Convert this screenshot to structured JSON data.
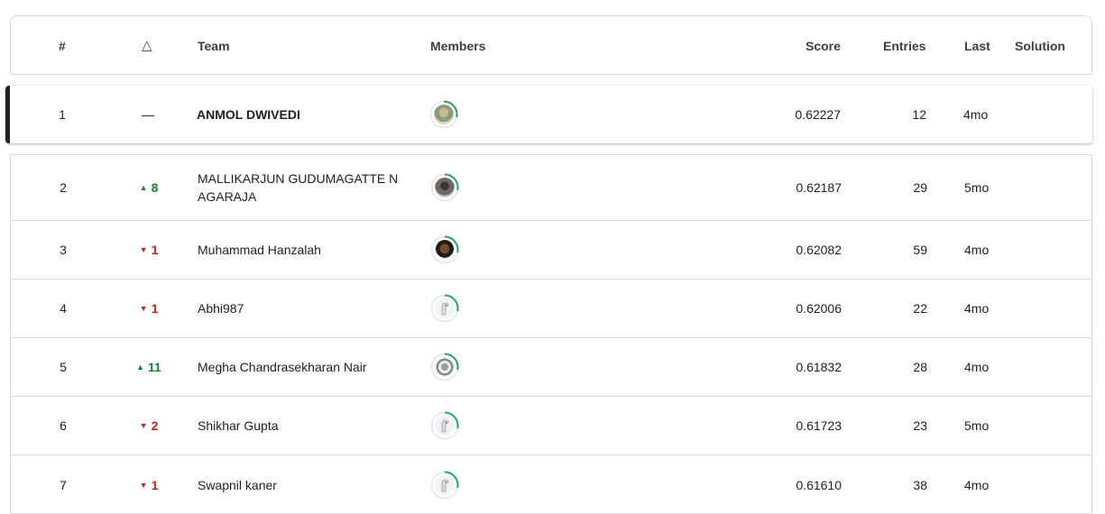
{
  "header": {
    "rank": "#",
    "delta": "△",
    "team": "Team",
    "members": "Members",
    "score": "Score",
    "entries": "Entries",
    "last": "Last",
    "solution": "Solution"
  },
  "you_row": {
    "rank": "1",
    "delta": "—",
    "team": "ANMOL DWIVEDI",
    "avatar": "photo-avatar",
    "score": "0.62227",
    "entries": "12",
    "last": "4mo"
  },
  "rows": [
    {
      "rank": "2",
      "delta_dir": "up",
      "delta": "8",
      "team": "MALLIKARJUN GUDUMAGATTE N AGARAJA",
      "avatar": "photo-avatar",
      "score": "0.62187",
      "entries": "29",
      "last": "5mo"
    },
    {
      "rank": "3",
      "delta_dir": "down",
      "delta": "1",
      "team": "Muhammad Hanzalah",
      "avatar": "photo-avatar",
      "score": "0.62082",
      "entries": "59",
      "last": "4mo"
    },
    {
      "rank": "4",
      "delta_dir": "down",
      "delta": "1",
      "team": "Abhi987",
      "avatar": "default-avatar",
      "score": "0.62006",
      "entries": "22",
      "last": "4mo"
    },
    {
      "rank": "5",
      "delta_dir": "up",
      "delta": "11",
      "team": "Megha Chandrasekharan Nair",
      "avatar": "photo-avatar",
      "score": "0.61832",
      "entries": "28",
      "last": "4mo"
    },
    {
      "rank": "6",
      "delta_dir": "down",
      "delta": "2",
      "team": "Shikhar Gupta",
      "avatar": "default-avatar",
      "score": "0.61723",
      "entries": "23",
      "last": "5mo"
    },
    {
      "rank": "7",
      "delta_dir": "down",
      "delta": "1",
      "team": "Swapnil kaner",
      "avatar": "default-avatar",
      "score": "0.61610",
      "entries": "38",
      "last": "4mo"
    }
  ],
  "colors": {
    "up": "#188038",
    "down": "#c5221f",
    "ring": "#20a464",
    "border": "#dadce0"
  }
}
